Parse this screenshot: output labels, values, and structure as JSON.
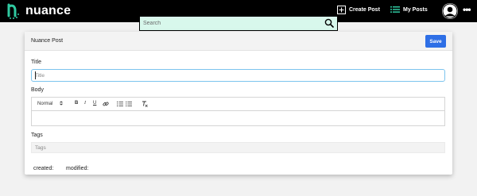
{
  "app": {
    "name": "nuance"
  },
  "search": {
    "placeholder": "Search"
  },
  "nav": {
    "create_post": "Create Post",
    "my_posts": "My Posts"
  },
  "card": {
    "title": "Nuance Post",
    "save_label": "Save"
  },
  "fields": {
    "title_label": "Title",
    "title_placeholder": "Title",
    "body_label": "Body",
    "tags_label": "Tags",
    "tags_placeholder": "Tags"
  },
  "editor": {
    "format_select": "Normal",
    "bold": "B",
    "italic": "I",
    "underline": "U"
  },
  "meta": {
    "created_label": "created:",
    "modified_label": "modified:"
  },
  "colors": {
    "topbar": "#000000",
    "search_bg": "#d8f8ec",
    "save_button": "#2e6fe6",
    "focus_border": "#7cc4ee",
    "logo_accent": "#2fc9a0"
  }
}
